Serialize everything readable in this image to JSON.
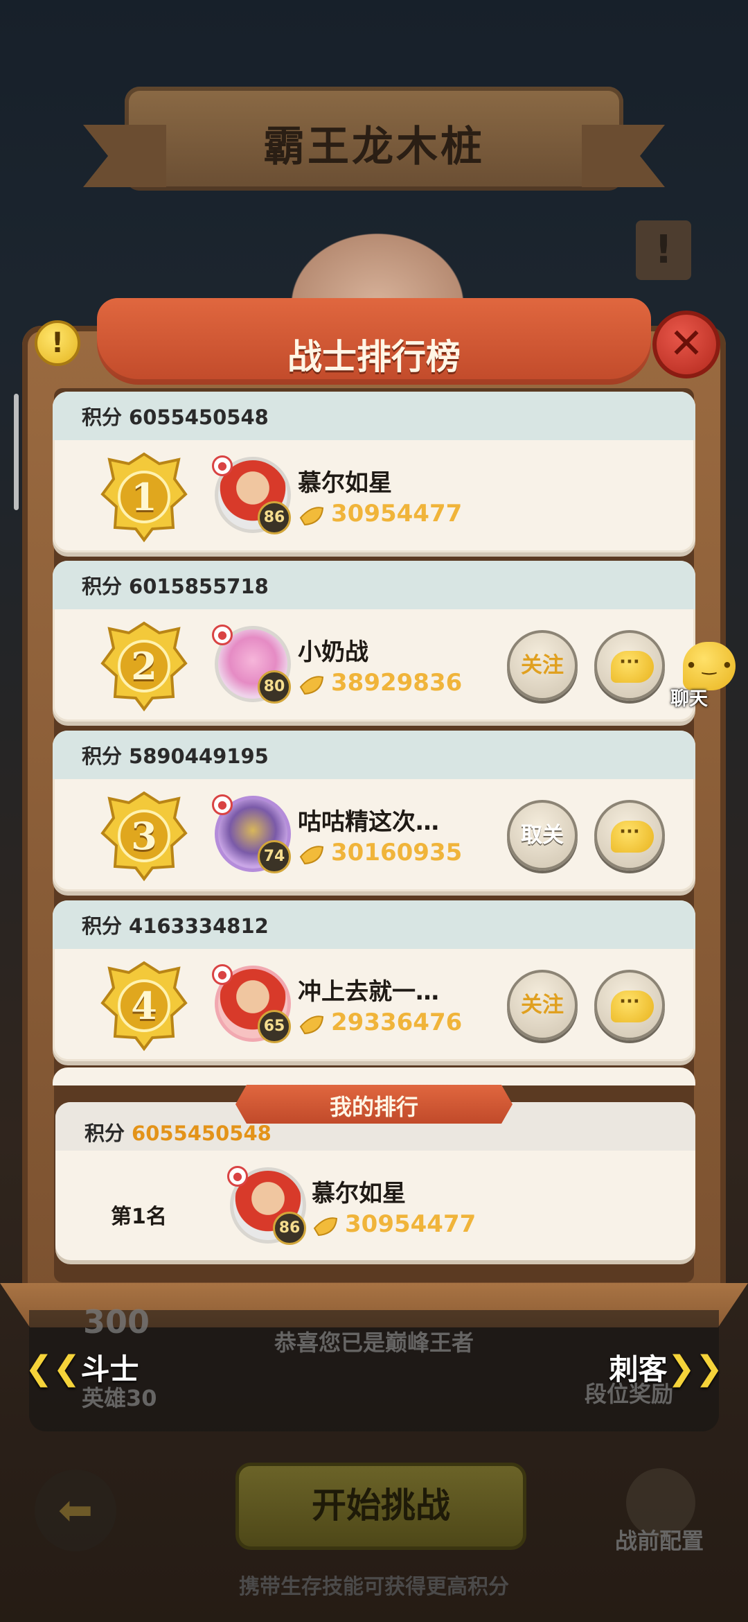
{
  "stage": {
    "title": "霸王龙木桩",
    "notice_glyph": "!"
  },
  "panel": {
    "title": "战士排行榜",
    "info_glyph": "!",
    "close_glyph": "✕"
  },
  "leaderboard": {
    "score_label": "积分",
    "follow_label": "关注",
    "unfollow_label": "取关",
    "chat_dots": "···",
    "entries": [
      {
        "rank": "1",
        "score": "6055450548",
        "name": "慕尔如星",
        "level": "86",
        "power": "30954477",
        "action": ""
      },
      {
        "rank": "2",
        "score": "6015855718",
        "name": "小奶战",
        "level": "80",
        "power": "38929836",
        "action": "关注"
      },
      {
        "rank": "3",
        "score": "5890449195",
        "name": "咕咕精这次…",
        "level": "74",
        "power": "30160935",
        "action": "取关"
      },
      {
        "rank": "4",
        "score": "4163334812",
        "name": "冲上去就一…",
        "level": "65",
        "power": "29336476",
        "action": "关注"
      }
    ]
  },
  "my_rank": {
    "title": "我的排行",
    "score_label": "积分",
    "score": "6055450548",
    "rank_text": "第1名",
    "name": "慕尔如星",
    "level": "86",
    "power": "30954477"
  },
  "chat_float": {
    "label": "聊天"
  },
  "bottom": {
    "congrats": "恭喜您已是巅峰王者",
    "left_class": "斗士",
    "right_class": "刺客",
    "hero_label": "英雄30",
    "reward_label": "段位奖励",
    "score_300": "300",
    "start_button": "开始挑战",
    "config_label": "战前配置",
    "hint": "携带生存技能可获得更高积分",
    "back_glyph": "⬅",
    "left_arrows": "❮❮",
    "right_arrows": "❯❯"
  },
  "colors": {
    "gold": "#f0b43a",
    "ribbon": "#d45a35",
    "card_bg": "#f8f2e8",
    "card_head": "#d8e5e3"
  }
}
